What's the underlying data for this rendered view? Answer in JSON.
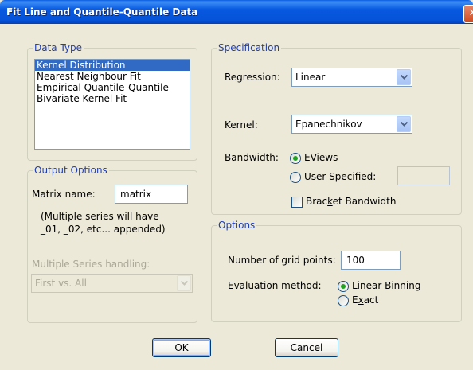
{
  "window": {
    "title": "Fit Line and Quantile-Quantile Data",
    "close_glyph": "✕"
  },
  "data_type": {
    "legend": "Data Type",
    "items": [
      "Kernel Distribution",
      "Nearest Neighbour Fit",
      "Empirical Quantile-Quantile",
      "Bivariate Kernel Fit"
    ],
    "selected": "Kernel Distribution"
  },
  "output_options": {
    "legend": "Output Options",
    "matrix_name_label": "Matrix name:",
    "matrix_name_value": "matrix",
    "note_line1": "(Multiple series will have",
    "note_line2": "_01, _02, etc... appended)",
    "multiple_series_label": "Multiple Series handling:",
    "multiple_series_value": "First vs. All"
  },
  "specification": {
    "legend": "Specification",
    "regression_label": "Regression:",
    "regression_value": "Linear",
    "kernel_label": "Kernel:",
    "kernel_value": "Epanechnikov",
    "bandwidth_label": "Bandwidth:",
    "eviews_option_first": "E",
    "eviews_option_rest": "Views",
    "eviews_selected": true,
    "user_specified_label": "User Specified:",
    "user_specified_value": "",
    "bracket_bandwidth_pre": "Brac",
    "bracket_bandwidth_key": "k",
    "bracket_bandwidth_post": "et Bandwidth",
    "bracket_bandwidth_checked": false
  },
  "options": {
    "legend": "Options",
    "grid_points_label": "Number of grid points:",
    "grid_points_value": "100",
    "evaluation_label": "Evaluation method:",
    "linear_binning_pre": "Linear Binnin",
    "linear_binning_key": "g",
    "exact_pre": "E",
    "exact_key": "x",
    "exact_post": "act",
    "linear_binning_selected": true
  },
  "buttons": {
    "ok_key": "O",
    "ok_rest": "K",
    "cancel_key": "C",
    "cancel_rest": "ancel"
  }
}
